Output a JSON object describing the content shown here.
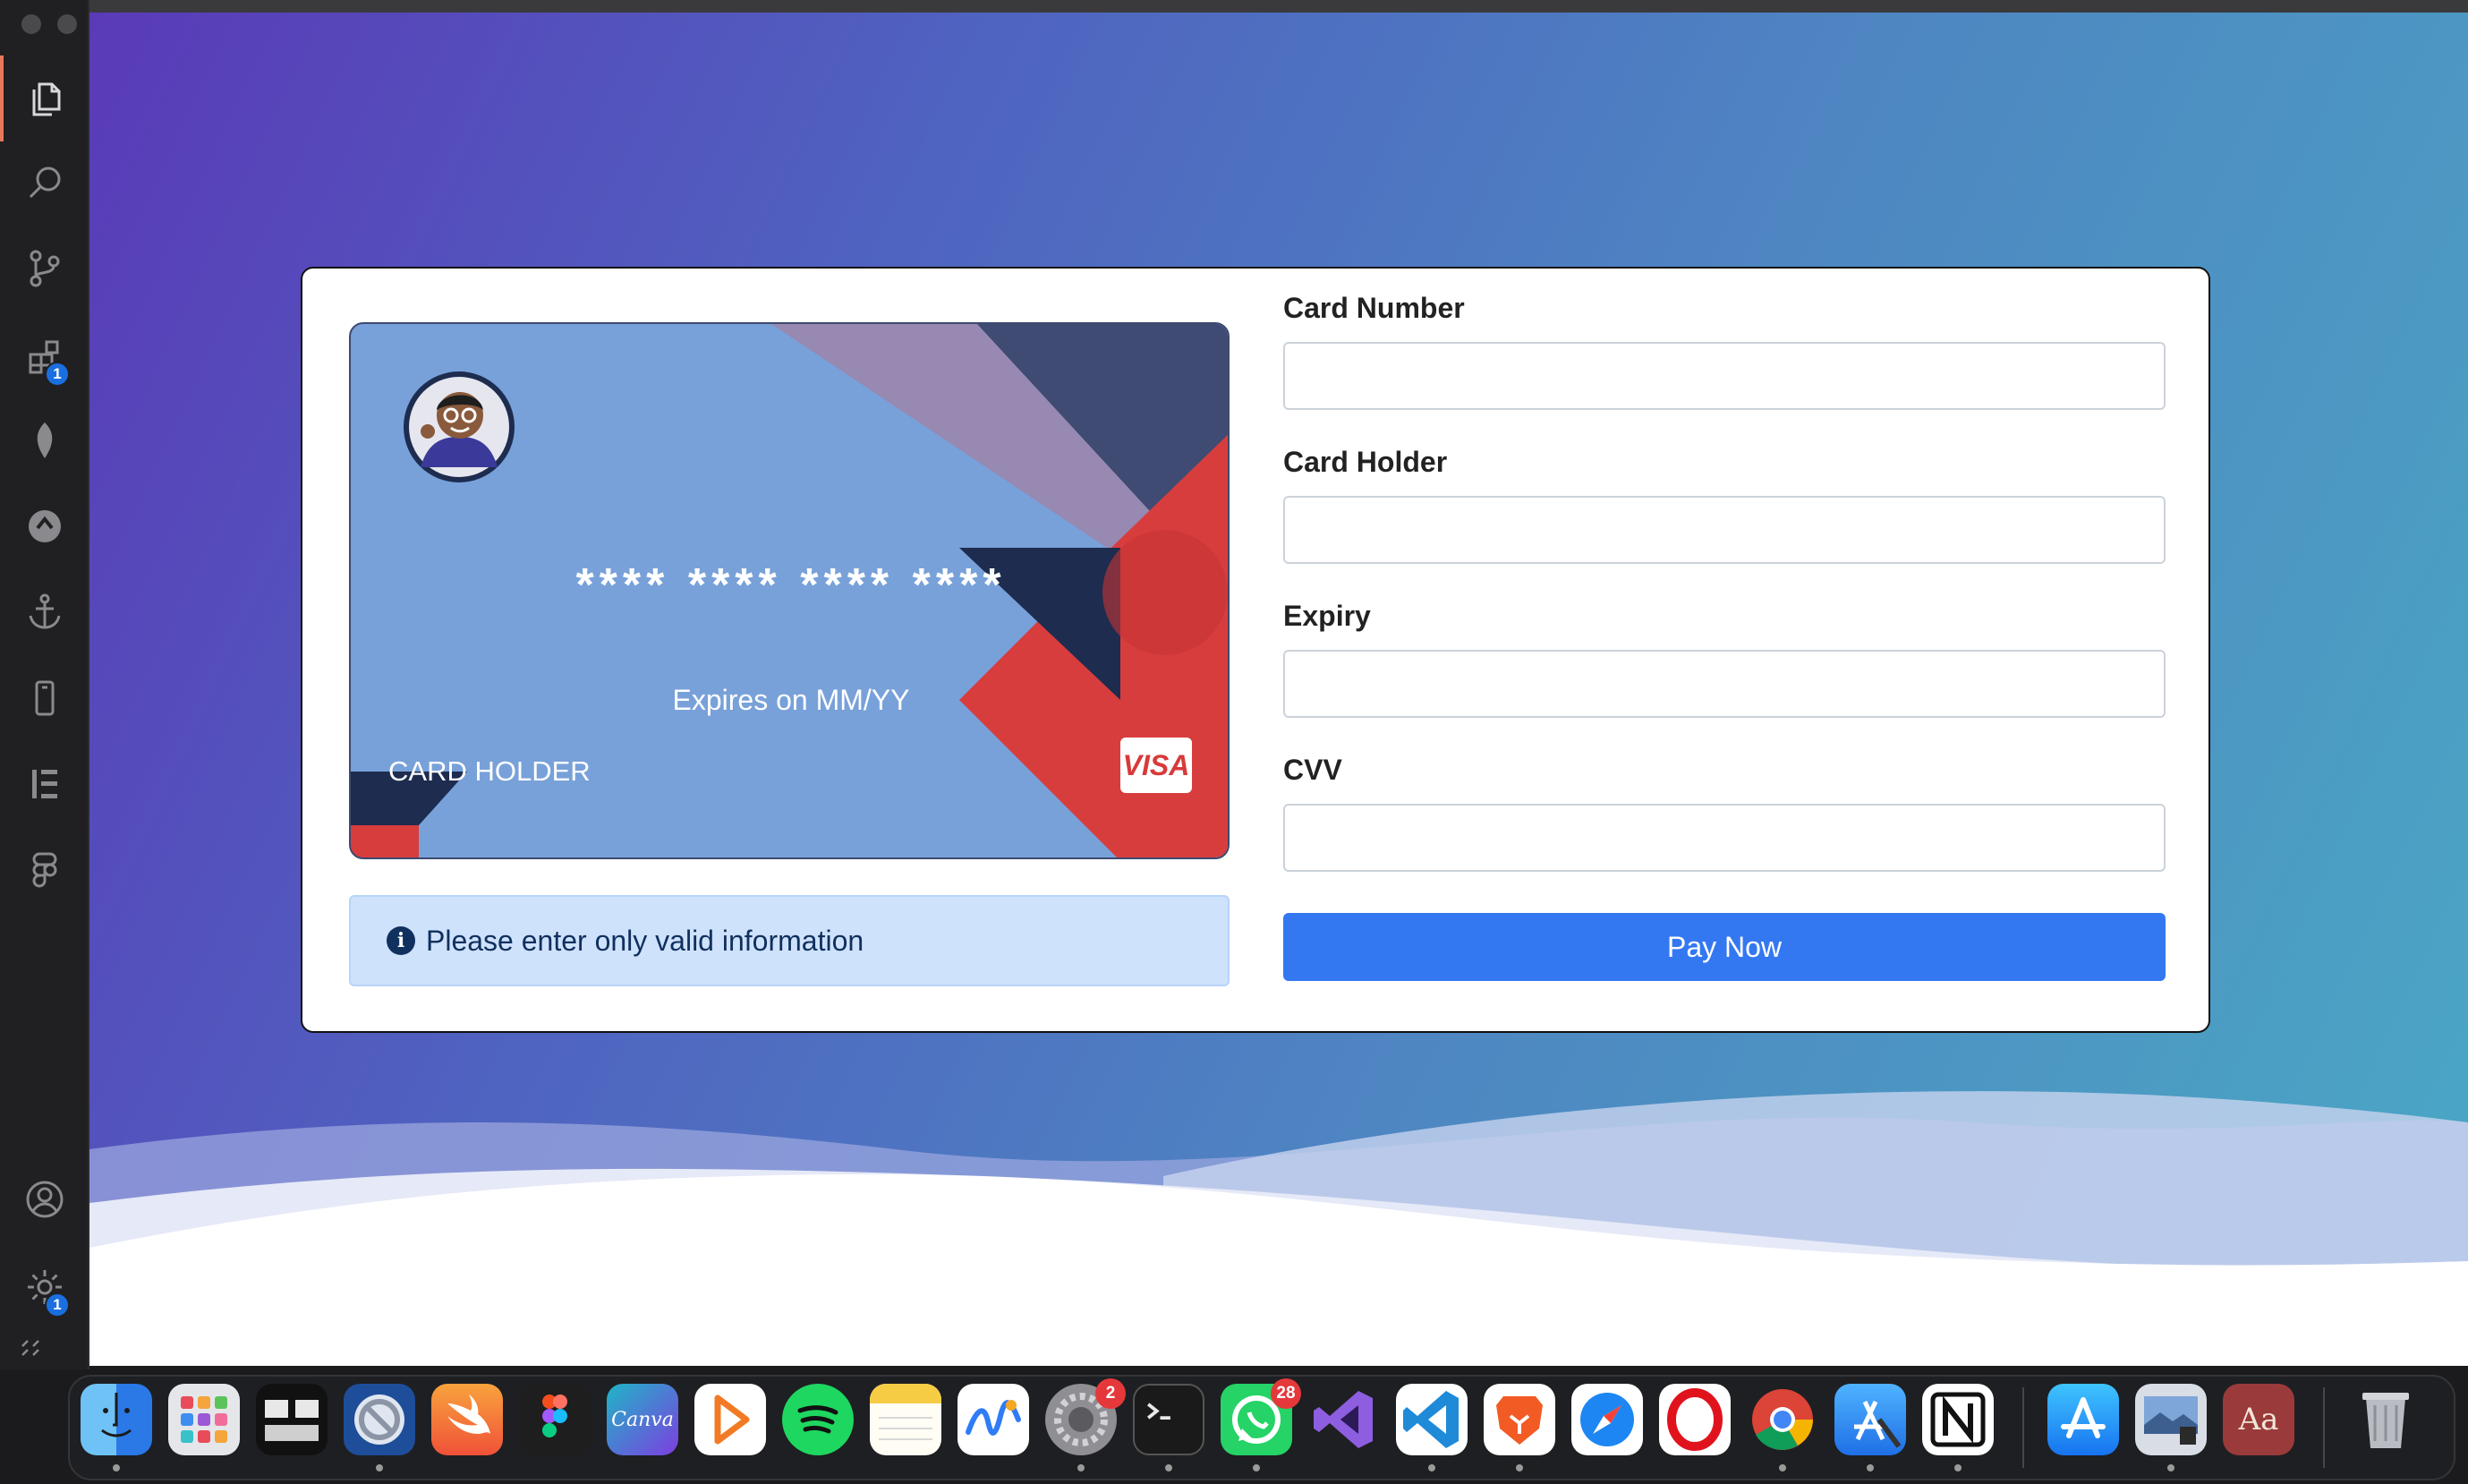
{
  "activity_bar": {
    "extensions_badge": "1",
    "settings_badge": "1"
  },
  "card_preview": {
    "number": "**** **** **** ****",
    "expiry": "Expires on MM/YY",
    "holder": "CARD HOLDER",
    "brand": "VISA"
  },
  "alert": {
    "message": "Please enter only valid information",
    "icon": "i"
  },
  "form": {
    "card_number_label": "Card Number",
    "card_number_value": "",
    "card_holder_label": "Card Holder",
    "card_holder_value": "",
    "expiry_label": "Expiry",
    "expiry_value": "",
    "cvv_label": "CVV",
    "cvv_value": "",
    "submit_label": "Pay Now"
  },
  "dock": {
    "system_settings_badge": "2",
    "whatsapp_badge": "28",
    "canva_label": "Canva",
    "dictionary_label": "Aa"
  },
  "colors": {
    "accent": "#3478f1",
    "alert_bg": "#cfe2fc",
    "card_bg": "#78a1d9",
    "card_red": "#d93c3c",
    "card_navy": "#1d2c4f"
  }
}
